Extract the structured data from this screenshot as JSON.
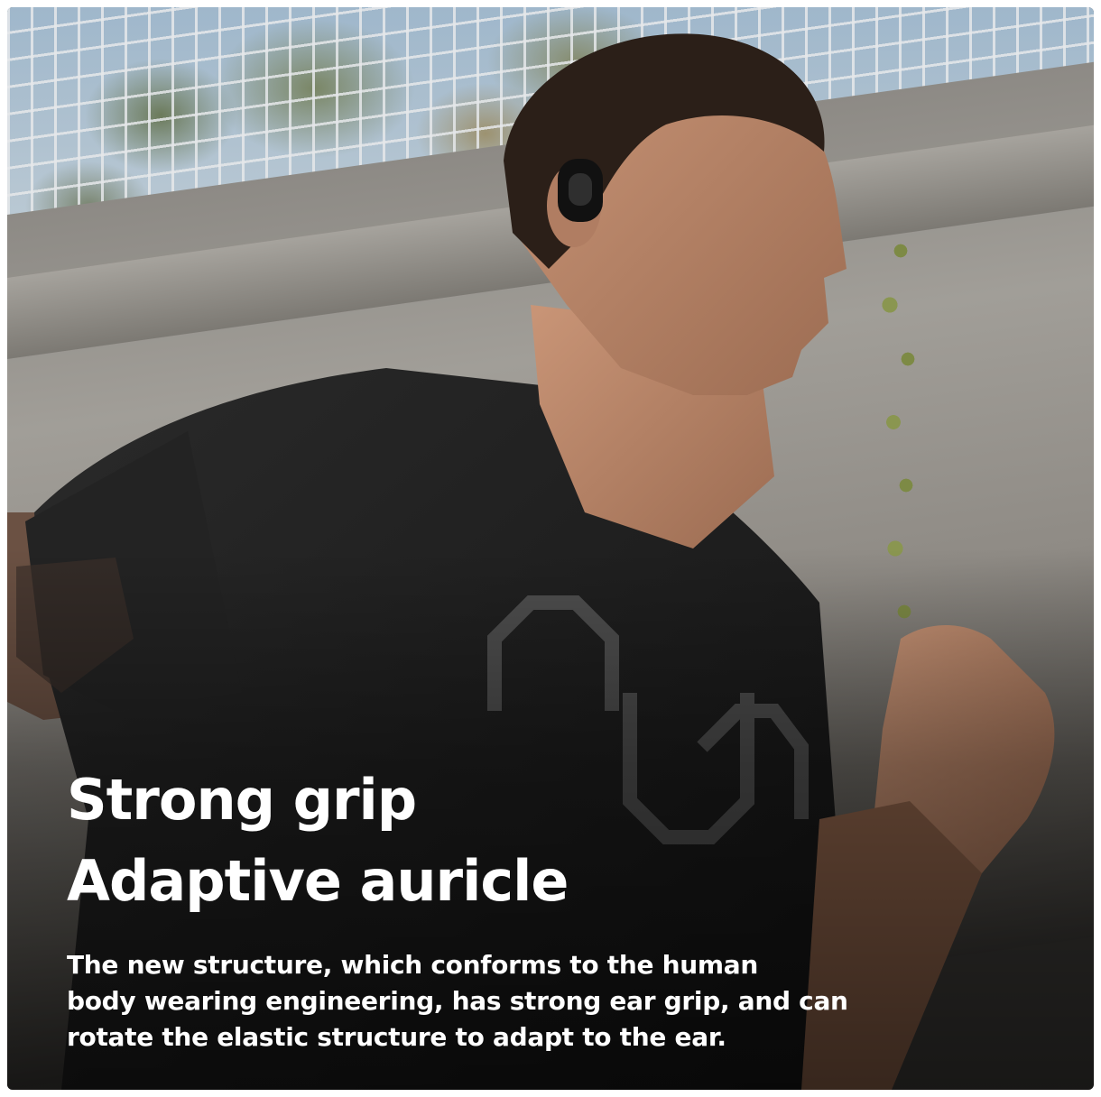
{
  "headline": {
    "line1": "Strong grip",
    "line2": "Adaptive auricle"
  },
  "description": {
    "line1": "The new structure, which conforms to the human",
    "line2": "body wearing engineering, has strong ear grip, and can",
    "line3": "rotate the elastic structure to adapt to the ear."
  },
  "colors": {
    "text": "#ffffff",
    "shirt": "#1c1c1c",
    "skin": "#b9876a",
    "wall": "#a19e98"
  }
}
